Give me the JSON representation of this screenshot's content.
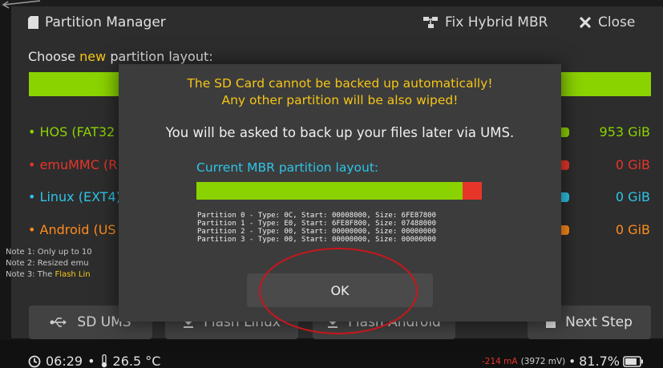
{
  "header": {
    "title": "Partition Manager",
    "fix_hybrid_mbr": "Fix Hybrid MBR",
    "close": "Close"
  },
  "subtitle": {
    "prefix": "Choose ",
    "highlight": "new",
    "suffix": " partition layout:"
  },
  "partitions": [
    {
      "label": "• HOS (FAT32",
      "size": "953 GiB",
      "color": "#8bd300"
    },
    {
      "label": "• emuMMC (R",
      "size": "0 GiB",
      "color": "#e8352a"
    },
    {
      "label": "• Linux (EXT4)",
      "size": "0 GiB",
      "color": "#2ec4e8"
    },
    {
      "label": "• Android (US",
      "size": "0 GiB",
      "color": "#ff8c1a"
    }
  ],
  "notes": {
    "note1": "Note 1: Only up to 10",
    "note2": "Note 2: Resized emu",
    "note3_prefix": "Note 3: The ",
    "note3_highlight": "Flash Lin"
  },
  "bottom": {
    "sd_ums": "SD UMS",
    "flash_linux": "Flash Linux",
    "flash_android": "Flash Android",
    "next_step": "Next Step"
  },
  "footer": {
    "time": "06:29",
    "sep": "•",
    "temp": "26.5 °C",
    "current": "-214 mA",
    "voltage": "(3972 mV)",
    "battery": "81.7%",
    "battery_level": 0.817
  },
  "dialog": {
    "warning_line1": "The SD Card cannot be backed up automatically!",
    "warning_line2": "Any other partition will be also wiped!",
    "info": "You will be asked to back up your files later via UMS.",
    "mbr_title": "Current MBR partition layout:",
    "partition_lines": [
      "Partition 0 - Type: 0C, Start: 00008000, Size: 6FE87800",
      "Partition 1 - Type: E0, Start: 6FE8F800, Size: 07488000",
      "Partition 2 - Type: 00, Start: 00000000, Size: 00000000",
      "Partition 3 - Type: 00, Start: 00000000, Size: 00000000"
    ],
    "ok": "OK"
  },
  "colors": {
    "accent_green": "#8bd300",
    "warning_yellow": "#f5c518",
    "info_cyan": "#2ec4e8",
    "danger_red": "#e8352a",
    "android_orange": "#ff8c1a",
    "annotation_red": "#c8161d"
  }
}
